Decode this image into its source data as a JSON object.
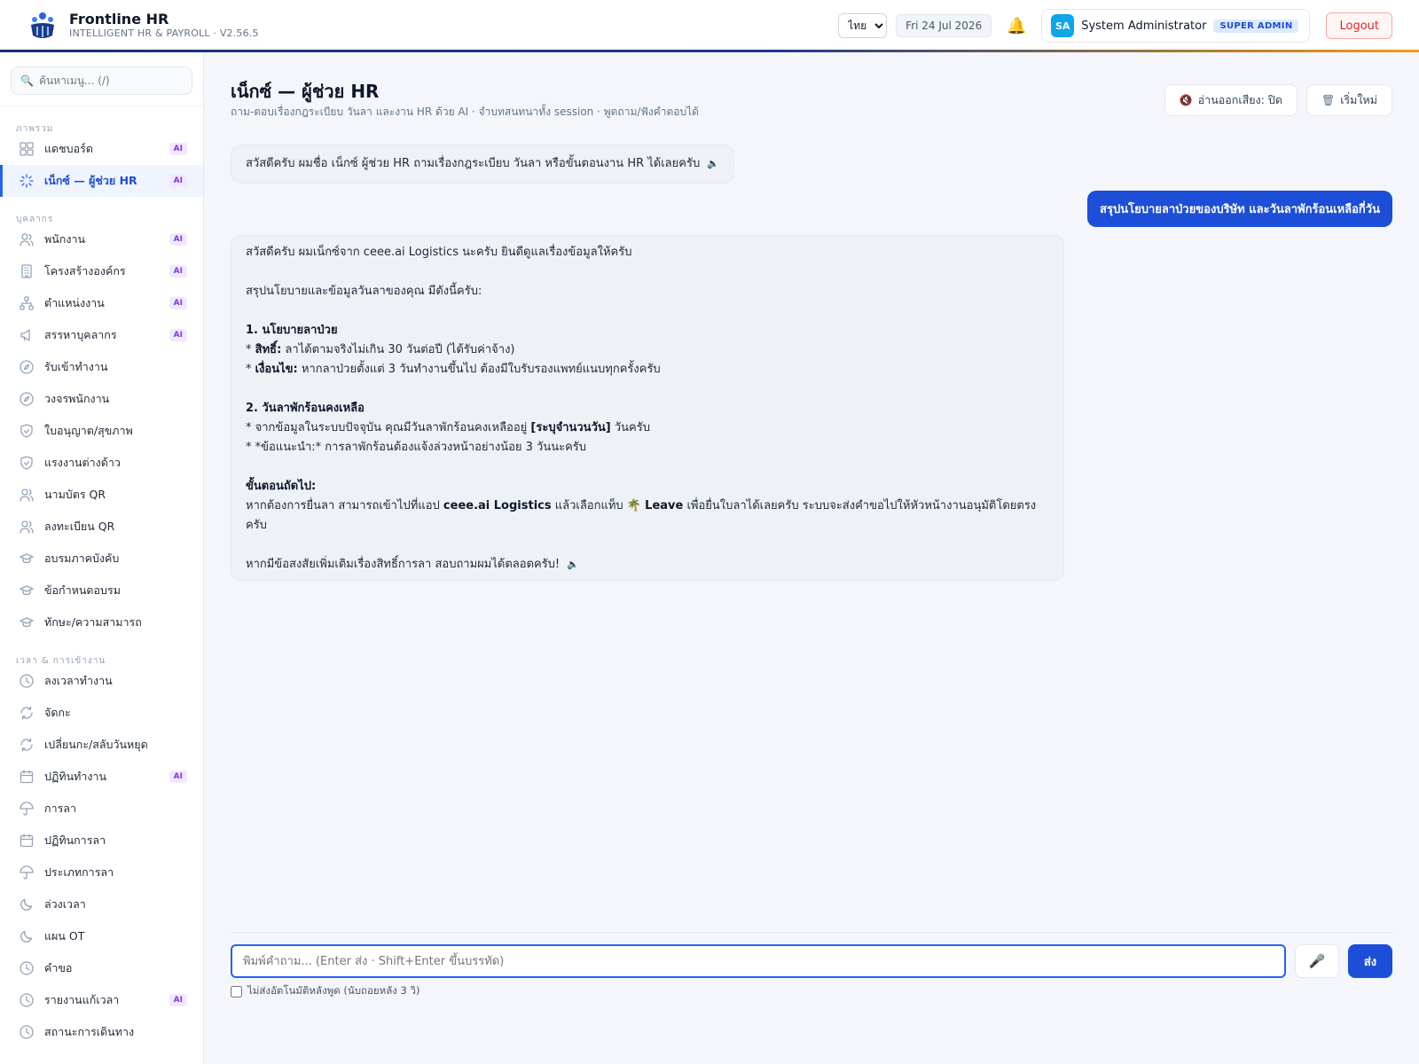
{
  "header": {
    "brand_title": "Frontline HR",
    "brand_sub": "INTELLIGENT HR & PAYROLL · V2.56.5",
    "language": "ไทย",
    "date": "Fri 24 Jul 2026",
    "user_initials": "SA",
    "user_name": "System Administrator",
    "role": "SUPER ADMIN",
    "logout_label": "Logout"
  },
  "sidebar": {
    "search_placeholder": "ค้นหาเมนู... (/)",
    "sections": [
      {
        "label": "ภาพรวม",
        "items": [
          {
            "label": "แดชบอร์ด",
            "icon": "grid-icon",
            "ai": "AI"
          },
          {
            "label": "เน็กซ์ — ผู้ช่วย HR",
            "icon": "sparkle-icon",
            "ai": "AI",
            "active": true
          }
        ]
      },
      {
        "label": "บุคลากร",
        "items": [
          {
            "label": "พนักงาน",
            "icon": "users-icon",
            "ai": "AI"
          },
          {
            "label": "โครงสร้างองค์กร",
            "icon": "building-icon",
            "ai": "AI"
          },
          {
            "label": "ตำแหน่งงาน",
            "icon": "org-chart-icon",
            "ai": "AI"
          },
          {
            "label": "สรรหาบุคลากร",
            "icon": "megaphone-icon",
            "ai": "AI"
          },
          {
            "label": "รับเข้าทำงาน",
            "icon": "compass-icon"
          },
          {
            "label": "วงจรพนักงาน",
            "icon": "compass-icon"
          },
          {
            "label": "ใบอนุญาต/สุขภาพ",
            "icon": "shield-icon"
          },
          {
            "label": "แรงงานต่างด้าว",
            "icon": "shield-icon"
          },
          {
            "label": "นามบัตร QR",
            "icon": "users-icon"
          },
          {
            "label": "ลงทะเบียน QR",
            "icon": "users-icon"
          },
          {
            "label": "อบรมภาคบังคับ",
            "icon": "graduation-cap-icon"
          },
          {
            "label": "ข้อกำหนดอบรม",
            "icon": "graduation-cap-icon"
          },
          {
            "label": "ทักษะ/ความสามารถ",
            "icon": "graduation-cap-icon"
          }
        ]
      },
      {
        "label": "เวลา & การเข้างาน",
        "items": [
          {
            "label": "ลงเวลาทำงาน",
            "icon": "clock-icon"
          },
          {
            "label": "จัดกะ",
            "icon": "refresh-icon"
          },
          {
            "label": "เปลี่ยนกะ/สลับวันหยุด",
            "icon": "refresh-icon"
          },
          {
            "label": "ปฏิทินทำงาน",
            "icon": "calendar-icon",
            "ai": "AI"
          },
          {
            "label": "การลา",
            "icon": "umbrella-icon"
          },
          {
            "label": "ปฏิทินการลา",
            "icon": "calendar-icon"
          },
          {
            "label": "ประเภทการลา",
            "icon": "umbrella-icon"
          },
          {
            "label": "ล่วงเวลา",
            "icon": "moon-icon"
          },
          {
            "label": "แผน OT",
            "icon": "moon-icon"
          },
          {
            "label": "คำขอ",
            "icon": "clock-icon"
          },
          {
            "label": "รายงานแก้เวลา",
            "icon": "clock-icon",
            "ai": "AI"
          },
          {
            "label": "สถานะการเดินทาง",
            "icon": "clock-icon"
          }
        ]
      }
    ]
  },
  "main": {
    "title": "เน็กซ์ — ผู้ช่วย HR",
    "subtitle": "ถาม-ตอบเรื่องกฎระเบียบ วันลา และงาน HR ด้วย AI · จำบทสนทนาทั้ง session · พูดถาม/ฟังคำตอบได้",
    "tts_label": "อ่านออกเสียง: ปิด",
    "reset_label": "เริ่มใหม่",
    "greeting": "สวัสดีครับ ผมชื่อ เน็กซ์ ผู้ช่วย HR ถามเรื่องกฎระเบียบ วันลา หรือขั้นตอนงาน HR ได้เลยครับ",
    "user_message": "สรุปนโยบายลาป่วยของบริษัท และวันลาพักร้อนเหลือกี่วัน",
    "answer": {
      "intro": "สวัสดีครับ ผมเน็กซ์จาก ceee.ai Logistics นะครับ ยินดีดูแลเรื่องข้อมูลให้ครับ",
      "summary": "สรุปนโยบายและข้อมูลวันลาของคุณ มีดังนี้ครับ:",
      "h1": "1. นโยบายลาป่วย",
      "s1_b1_label": "สิทธิ์:",
      "s1_b1_text": "ลาได้ตามจริงไม่เกิน 30 วันต่อปี (ได้รับค่าจ้าง)",
      "s1_b2_label": "เงื่อนไข:",
      "s1_b2_text": "หากลาป่วยตั้งแต่ 3 วันทำงานขึ้นไป ต้องมีใบรับรองแพทย์แนบทุกครั้งครับ",
      "h2": "2. วันลาพักร้อนคงเหลือ",
      "s2_b1_text": "จากข้อมูลในระบบปัจจุบัน คุณมีวันลาพักร้อนคงเหลืออยู่",
      "s2_b1_bold": "[ระบุจำนวนวัน]",
      "s2_b1_tail": "วันครับ",
      "s2_b2_text": "*ข้อแนะนำ:* การลาพักร้อนต้องแจ้งล่วงหน้าอย่างน้อย 3 วันนะครับ",
      "h3": "ขั้นตอนถัดไป:",
      "next_a": "หากต้องการยื่นลา สามารถเข้าไปที่แอป",
      "next_app": "ceee.ai Logistics",
      "next_b": "แล้วเลือกแท็บ 🌴",
      "next_tab": "Leave",
      "next_c": "เพื่อยื่นใบลาได้เลยครับ ระบบจะส่งคำขอไปให้หัวหน้างานอนุมัติโดยตรงครับ",
      "closing": "หากมีข้อสงสัยเพิ่มเติมเรื่องสิทธิ์การลา สอบถามผมได้ตลอดครับ!"
    },
    "input_placeholder": "พิมพ์คำถาม... (Enter ส่ง · Shift+Enter ขึ้นบรรทัด)",
    "send_label": "ส่ง",
    "auto_send_label": "ไม่ส่งอัตโนมัติหลังพูด (นับถอยหลัง 3 วิ)"
  },
  "colors": {
    "accent": "#1d4ed8",
    "ai_badge": "#7c3aed",
    "logout": "#dc2626"
  }
}
